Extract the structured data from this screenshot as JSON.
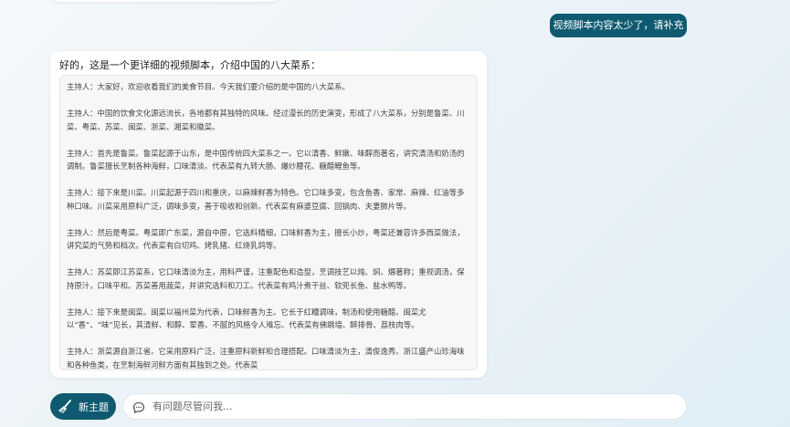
{
  "user_message": "视频脚本内容太少了，请补充",
  "assistant": {
    "intro": "好的，这是一个更详细的视频脚本，介绍中国的八大菜系：",
    "script_paragraphs": [
      "主持人：大家好，欢迎收看我们的美食节目。今天我们要介绍的是中国的八大菜系。",
      "主持人：中国的饮食文化源远流长，各地都有其独特的风味。经过漫长的历史演变，形成了八大菜系，分别是鲁菜、川菜、粤菜、苏菜、闽菜、浙菜、湘菜和徽菜。",
      "主持人：首先是鲁菜。鲁菜起源于山东，是中国传统四大菜系之一。它以清香、鲜嫩、味醇而著名，讲究清汤和奶汤的调制。鲁菜擅长烹制各种海鲜，口味清淡。代表菜有九转大肠、爆炒腰花、糖醋鲤鱼等。",
      "主持人：接下来是川菜。川菜起源于四川和重庆，以麻辣鲜香为特色。它口味多变，包含鱼香、家常、麻辣、红油等多种口味。川菜采用原料广泛，调味多变，善于吸收和创新。代表菜有麻婆豆腐、回锅肉、夫妻肺片等。",
      "主持人：然后是粤菜。粤菜即广东菜，源自中原，它选料精细，口味鲜香为主，擅长小炒，粤菜还兼容许多西菜做法，讲究菜的气势和档次。代表菜有白切鸡、烤乳猪、红烧乳鸽等。",
      "主持人：苏菜即江苏菜系，它口味清淡为主，用料严谨，注重配色和造型，烹调技艺以炖、焖、煨著称；重视调汤，保持原汁，口味平和。苏菜善用蔬菜，并讲究选料和刀工。代表菜有鸡汁煮干丝、软兜长鱼、盐水鸭等。",
      "主持人：接下来是闽菜。闽菜以福州菜为代表，口味鲜香为主。它长于红糟调味，制汤和使用糖醋。闽菜尤以“香”、“味”见长，其清鲜、和醇、荤香、不腻的风格令人难忘。代表菜有佛跳墙、醉排骨、荔枝肉等。",
      "主持人：浙菜源自浙江省。它采用原料广泛，注重原料新鲜和合理搭配。口味清淡为主，清俊逸秀。浙江盛产山珍海味和各种鱼类，在烹制海鲜河鲜方面有其独到之处。代表菜"
    ]
  },
  "new_topic_label": "新主题",
  "input": {
    "placeholder": "有问题尽管问我...",
    "value": ""
  },
  "colors": {
    "accent": "#0f5a70",
    "background": "#eaf2f7",
    "card": "#ffffff"
  },
  "icons": {
    "new_topic": "broom-icon",
    "input": "chat-bubble-icon"
  }
}
